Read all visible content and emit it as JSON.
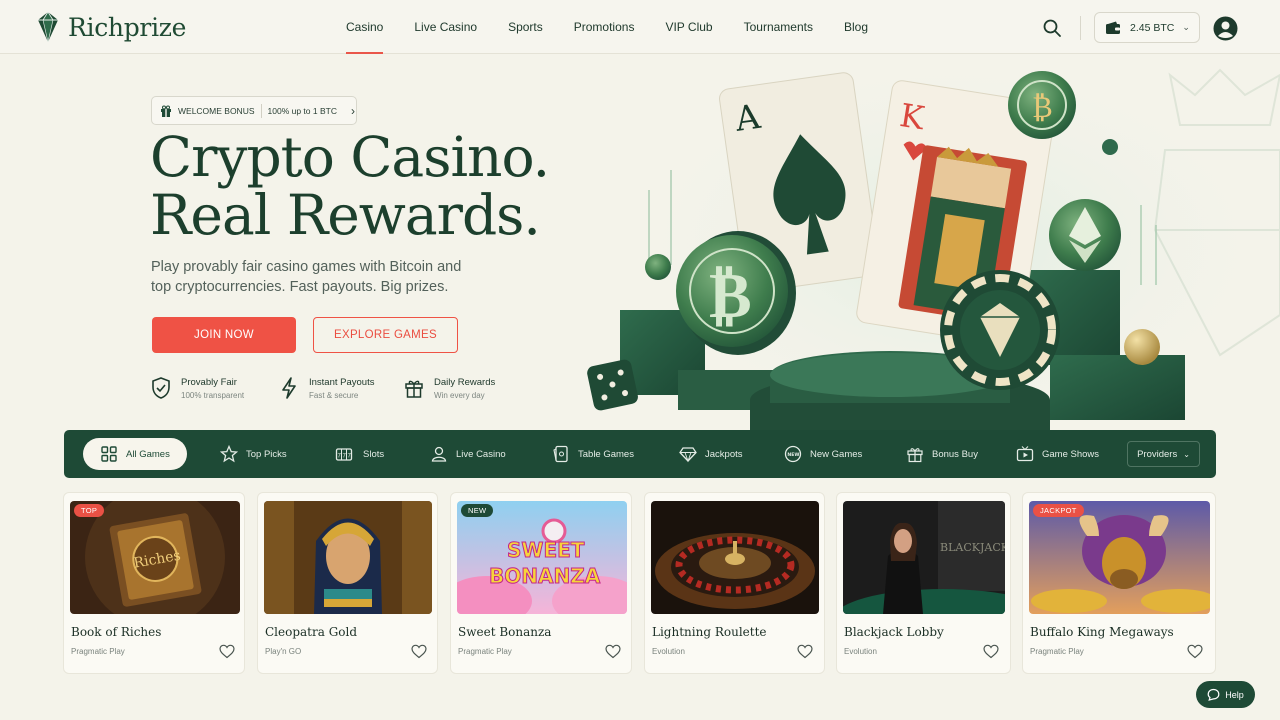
{
  "brand": {
    "name": "Richprize"
  },
  "nav": {
    "items": [
      {
        "label": "Casino",
        "active": true
      },
      {
        "label": "Live Casino"
      },
      {
        "label": "Sports"
      },
      {
        "label": "Promotions"
      },
      {
        "label": "VIP Club"
      },
      {
        "label": "Tournaments"
      },
      {
        "label": "Blog"
      }
    ]
  },
  "header": {
    "search_icon": "search-icon",
    "wallet": {
      "balance": "2.45 BTC",
      "icon": "wallet-icon"
    },
    "avatar_icon": "user-icon"
  },
  "hero": {
    "bonus": {
      "tag": "WELCOME BONUS",
      "offer": "100% up to 1 BTC"
    },
    "title_line1": "Crypto Casino.",
    "title_line2": "Real Rewards.",
    "subtitle": "Play provably fair casino games with Bitcoin and top cryptocurrencies. Fast payouts. Big prizes.",
    "join_label": "JOIN NOW",
    "explore_label": "EXPLORE GAMES",
    "features": [
      {
        "title": "Provably Fair",
        "sub": "100% transparent",
        "icon": "shield-check-icon"
      },
      {
        "title": "Instant Payouts",
        "sub": "Fast & secure",
        "icon": "lightning-icon"
      },
      {
        "title": "Daily Rewards",
        "sub": "Win every day",
        "icon": "gift-icon"
      }
    ]
  },
  "categories": {
    "items": [
      {
        "label": "All Games",
        "icon": "grid-icon",
        "active": true
      },
      {
        "label": "Top Picks",
        "icon": "star-icon"
      },
      {
        "label": "Slots",
        "icon": "slot-machine-icon"
      },
      {
        "label": "Live Casino",
        "icon": "dealer-icon"
      },
      {
        "label": "Table Games",
        "icon": "card-icon"
      },
      {
        "label": "Jackpots",
        "icon": "diamond-icon"
      },
      {
        "label": "New Games",
        "icon": "new-badge-icon"
      },
      {
        "label": "Bonus Buy",
        "icon": "gift-icon"
      },
      {
        "label": "Game Shows",
        "icon": "tv-icon"
      }
    ],
    "providers_label": "Providers"
  },
  "games": [
    {
      "title": "Book of Riches",
      "provider": "Pragmatic Play",
      "badge": "TOP",
      "badge_color": "#ea5145"
    },
    {
      "title": "Cleopatra Gold",
      "provider": "Play'n GO",
      "badge": ""
    },
    {
      "title": "Sweet Bonanza",
      "provider": "Pragmatic Play",
      "badge": "NEW",
      "badge_color": "#1e4a36"
    },
    {
      "title": "Lightning Roulette",
      "provider": "Evolution",
      "badge": ""
    },
    {
      "title": "Blackjack Lobby",
      "provider": "Evolution",
      "badge": ""
    },
    {
      "title": "Buffalo King Megaways",
      "provider": "Pragmatic Play",
      "badge": "JACKPOT",
      "badge_color": "#ea5145"
    }
  ],
  "game_thumb_text": {
    "book": "Riches",
    "bonanza_1": "SWEET",
    "bonanza_2": "BONANZA",
    "blackjack": "BLACKJACK"
  },
  "hero_art": {
    "card_ace": "A",
    "card_king": "K"
  },
  "help": {
    "label": "Help"
  },
  "colors": {
    "brand_green": "#1e4a36",
    "accent_red": "#ef5245",
    "background": "#f4f3ea"
  }
}
